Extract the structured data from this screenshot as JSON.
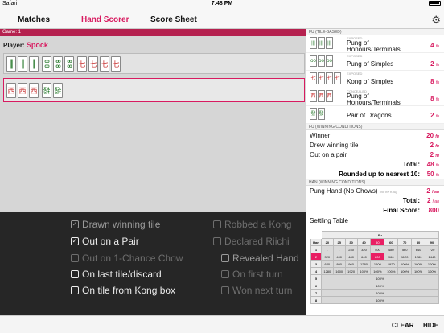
{
  "status": {
    "carrier": "Safari",
    "time": "7:48 PM",
    "battery": ""
  },
  "tabs": {
    "matches": "Matches",
    "hand_scorer": "Hand Scorer",
    "score_sheet": "Score Sheet"
  },
  "game": {
    "label": "Game: 1",
    "player_label": "Player:",
    "player_name": "Spock"
  },
  "options": {
    "drawn": "Drawn winning tile",
    "out_on_pair": "Out on a Pair",
    "one_chance": "Out on 1-Chance Chow",
    "last_tile": "On last tile/discard",
    "kong_box": "On tile from Kong box",
    "robbed_kong": "Robbed a Kong",
    "declared_riichi": "Declared Riichi",
    "revealed_hand": "Revealed Hand",
    "first_turn": "On first turn",
    "won_next_turn": "Won next turn"
  },
  "bottom": {
    "clear": "CLEAR",
    "hide": "HIDE"
  },
  "fu_tile": {
    "header": "FU (TILE-BASED)",
    "rows": [
      {
        "tag": "EXPOSED",
        "label1": "Pung of",
        "label2": "Honours/Terminals",
        "value": "4"
      },
      {
        "tag": "EXPOSED",
        "label1": "Pung of Simples",
        "label2": "",
        "value": "2"
      },
      {
        "tag": "EXPOSED",
        "label1": "Kong of Simples",
        "label2": "",
        "value": "8"
      },
      {
        "tag": "CONCEALED",
        "label1": "Pung of",
        "label2": "Honours/Terminals",
        "value": "8"
      },
      {
        "tag": "",
        "label1": "Pair of Dragons",
        "label2": "",
        "value": "2"
      }
    ],
    "unit": "fu"
  },
  "fu_win": {
    "header": "FU (WINNING CONDITIONS)",
    "winner": "Winner",
    "winner_val": "20",
    "drew": "Drew winning tile",
    "drew_val": "2",
    "pair": "Out on a pair",
    "pair_val": "2",
    "total_label": "Total:",
    "total_val": "48",
    "round_label": "Rounded up to nearest 10:",
    "round_val": "50"
  },
  "han": {
    "header": "HAN (WINNING CONDITIONS)",
    "pung_hand": "Pung Hand (No Chows)",
    "note": "(No for Kou)",
    "pung_val": "2",
    "unit": "han",
    "total_label": "Total:",
    "total_val": "2",
    "final_label": "Final Score:",
    "final_val": "800"
  },
  "settle": {
    "title": "Settling Table",
    "fu_label": "Fu",
    "han_label": "Han",
    "cols": [
      "20",
      "25",
      "30",
      "40",
      "50",
      "60",
      "70",
      "80",
      "90"
    ],
    "rows": [
      {
        "han": "1",
        "cells": [
          "-",
          "-",
          "240",
          "320",
          "400",
          "480",
          "560",
          "640",
          "720"
        ]
      },
      {
        "han": "2",
        "cells": [
          "320",
          "400",
          "480",
          "640",
          "800",
          "960",
          "1120",
          "1280",
          "1440"
        ]
      },
      {
        "han": "3",
        "cells": [
          "640",
          "800",
          "960",
          "1280",
          "1600",
          "1920",
          "100%",
          "100%",
          "100%"
        ]
      },
      {
        "han": "4",
        "cells": [
          "1280",
          "1600",
          "1920",
          "100%",
          "100%",
          "100%",
          "100%",
          "100%",
          "100%"
        ]
      },
      {
        "han": "5",
        "span": "100%"
      },
      {
        "han": "6",
        "span": "100%"
      },
      {
        "han": "7",
        "span": "100%"
      },
      {
        "han": "8",
        "span": "100%"
      }
    ]
  }
}
